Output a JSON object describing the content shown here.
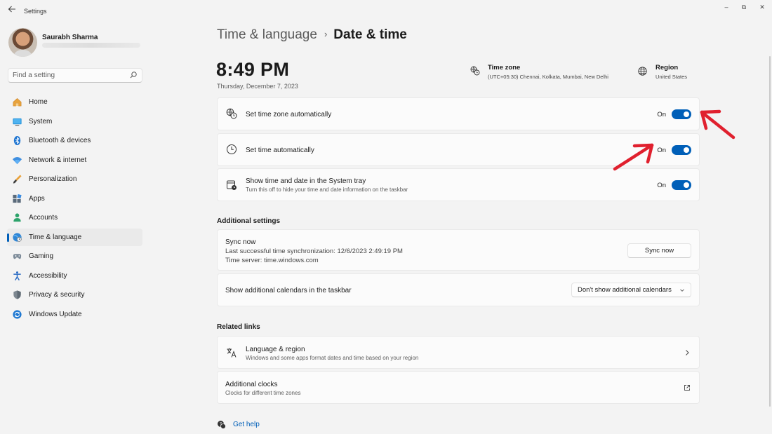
{
  "window": {
    "title": "Settings",
    "back_icon": "back-arrow-icon",
    "minimize_glyph": "–",
    "maximize_glyph": "⧉",
    "close_glyph": "✕"
  },
  "user": {
    "name": "Saurabh Sharma"
  },
  "search": {
    "placeholder": "Find a setting"
  },
  "sidebar": {
    "items": [
      {
        "label": "Home",
        "icon": "home-icon"
      },
      {
        "label": "System",
        "icon": "system-icon"
      },
      {
        "label": "Bluetooth & devices",
        "icon": "bluetooth-icon"
      },
      {
        "label": "Network & internet",
        "icon": "network-icon"
      },
      {
        "label": "Personalization",
        "icon": "personalization-icon"
      },
      {
        "label": "Apps",
        "icon": "apps-icon"
      },
      {
        "label": "Accounts",
        "icon": "accounts-icon"
      },
      {
        "label": "Time & language",
        "icon": "time-language-icon",
        "active": true
      },
      {
        "label": "Gaming",
        "icon": "gaming-icon"
      },
      {
        "label": "Accessibility",
        "icon": "accessibility-icon"
      },
      {
        "label": "Privacy & security",
        "icon": "privacy-icon"
      },
      {
        "label": "Windows Update",
        "icon": "windows-update-icon"
      }
    ]
  },
  "breadcrumb": {
    "parent": "Time & language",
    "separator": "›",
    "current": "Date & time"
  },
  "clock": {
    "time": "8:49 PM",
    "date": "Thursday, December 7, 2023"
  },
  "timezone": {
    "title": "Time zone",
    "value": "(UTC+05:30) Chennai, Kolkata, Mumbai, New Delhi"
  },
  "region": {
    "title": "Region",
    "value": "United States"
  },
  "settings": {
    "auto_timezone": {
      "title": "Set time zone automatically",
      "state": "On"
    },
    "auto_time": {
      "title": "Set time automatically",
      "state": "On"
    },
    "tray": {
      "title": "Show time and date in the System tray",
      "desc": "Turn this off to hide your time and date information on the taskbar",
      "state": "On"
    }
  },
  "additional": {
    "heading": "Additional settings",
    "sync_title": "Sync now",
    "sync_last": "Last successful time synchronization: 12/6/2023 2:49:19 PM",
    "sync_server": "Time server: time.windows.com",
    "sync_button": "Sync now",
    "calendars_title": "Show additional calendars in the taskbar",
    "calendars_value": "Don't show additional calendars"
  },
  "related": {
    "heading": "Related links",
    "language_title": "Language & region",
    "language_desc": "Windows and some apps format dates and time based on your region",
    "clocks_title": "Additional clocks",
    "clocks_desc": "Clocks for different time zones"
  },
  "help": {
    "label": "Get help"
  },
  "colors": {
    "accent": "#005fb8",
    "annotation_arrow": "#e0202e",
    "background": "#f3f3f3",
    "card": "#fbfbfb"
  }
}
